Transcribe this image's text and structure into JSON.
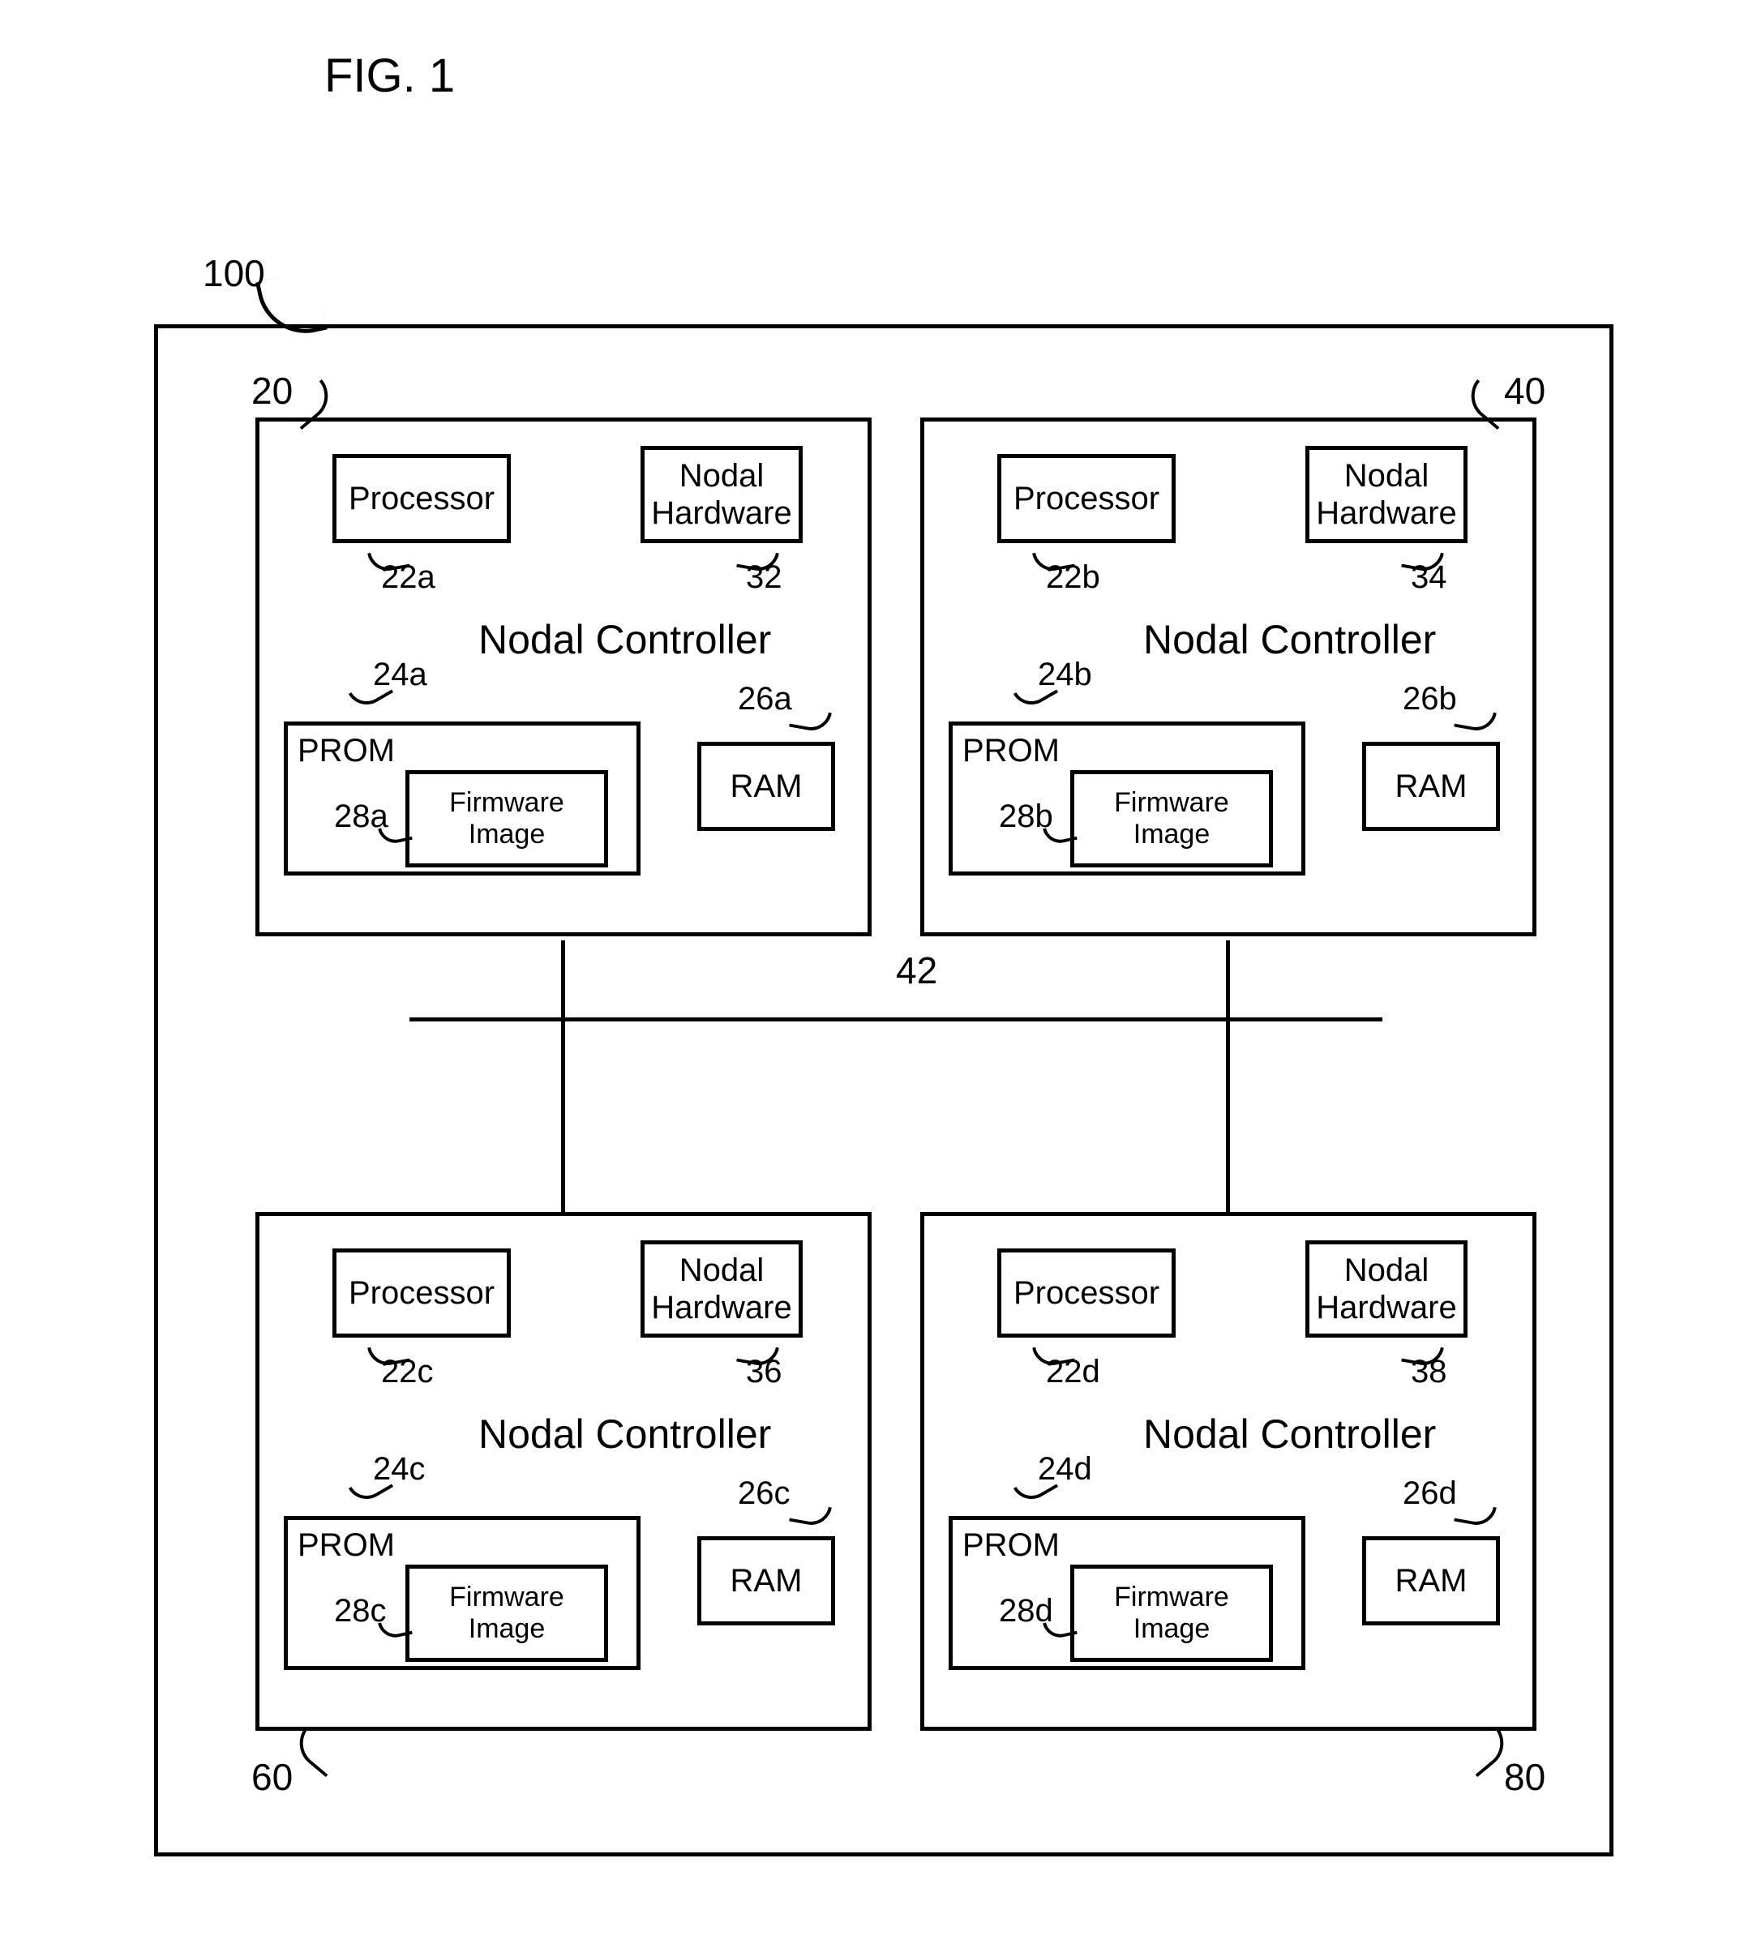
{
  "figure_title": "FIG. 1",
  "system_ref": "100",
  "bus_ref": "42",
  "common": {
    "processor": "Processor",
    "nodal_hw": "Nodal Hardware",
    "nodal_ctrl": "Nodal Controller",
    "prom": "PROM",
    "firmware": "Firmware Image",
    "ram": "RAM"
  },
  "nodes": {
    "tl": {
      "node_ref": "20",
      "proc_ref": "22a",
      "hw_ref": "32",
      "nc_ref": "24a",
      "ram_ref": "26a",
      "fw_ref": "28a"
    },
    "tr": {
      "node_ref": "40",
      "proc_ref": "22b",
      "hw_ref": "34",
      "nc_ref": "24b",
      "ram_ref": "26b",
      "fw_ref": "28b"
    },
    "bl": {
      "node_ref": "60",
      "proc_ref": "22c",
      "hw_ref": "36",
      "nc_ref": "24c",
      "ram_ref": "26c",
      "fw_ref": "28c"
    },
    "br": {
      "node_ref": "80",
      "proc_ref": "22d",
      "hw_ref": "38",
      "nc_ref": "24d",
      "ram_ref": "26d",
      "fw_ref": "28d"
    }
  }
}
